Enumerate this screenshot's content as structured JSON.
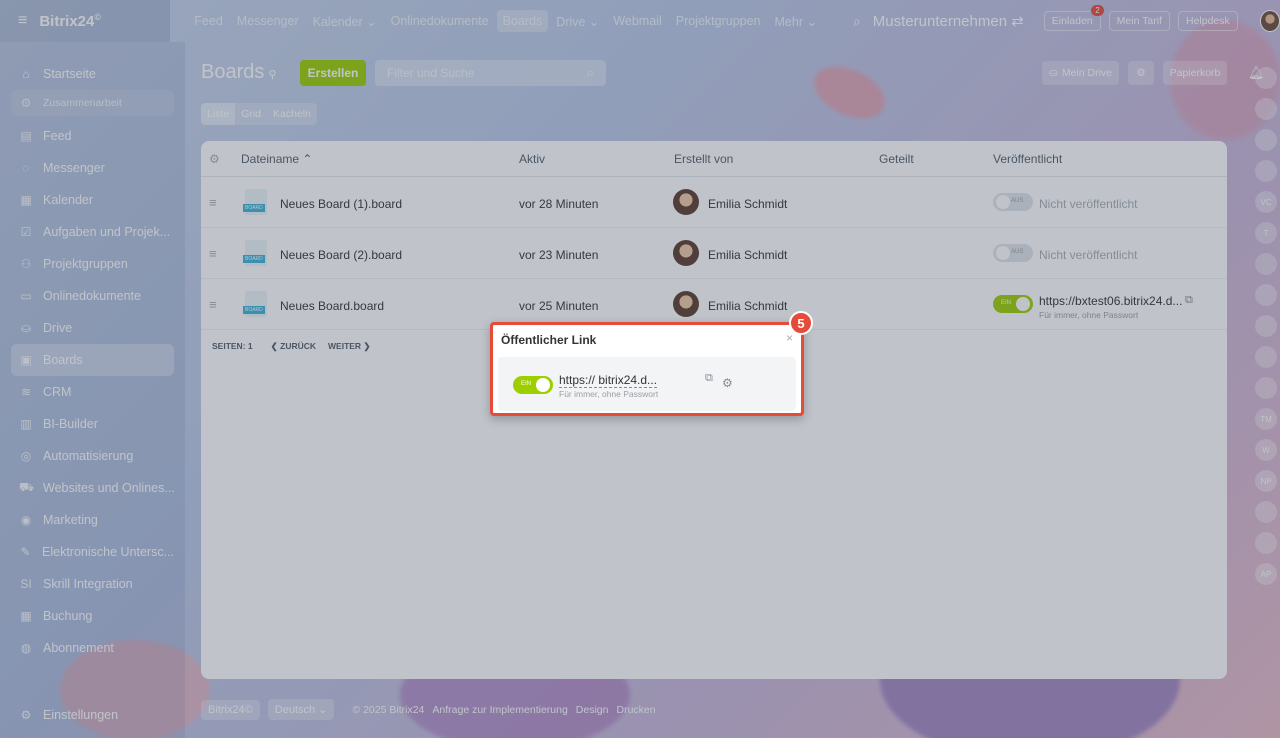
{
  "app": {
    "logo": "Bitrix24",
    "logo_mark": "©"
  },
  "nav": {
    "items": [
      "Feed",
      "Messenger",
      "Kalender ⌄",
      "Onlinedokumente",
      "Boards",
      "Drive ⌄",
      "Webmail",
      "Projektgruppen",
      "Mehr ⌄"
    ],
    "active_index": 4,
    "company": "Musterunternehmen ⇄",
    "invite_label": "Einladen",
    "invite_badge": "2",
    "tariff_label": "Mein Tarif",
    "helpdesk_label": "Helpdesk"
  },
  "sidebar": {
    "items": [
      {
        "icon": "⌂",
        "label": "Startseite",
        "type": "item"
      },
      {
        "icon": "⚙",
        "label": "Zusammenarbeit",
        "type": "section"
      },
      {
        "icon": "▤",
        "label": "Feed",
        "type": "item"
      },
      {
        "icon": "◌",
        "label": "Messenger",
        "type": "item"
      },
      {
        "icon": "▦",
        "label": "Kalender",
        "type": "item"
      },
      {
        "icon": "☑",
        "label": "Aufgaben und Projek...",
        "type": "item"
      },
      {
        "icon": "⚇",
        "label": "Projektgruppen",
        "type": "item"
      },
      {
        "icon": "▭",
        "label": "Onlinedokumente",
        "type": "item"
      },
      {
        "icon": "⛀",
        "label": "Drive",
        "type": "item"
      },
      {
        "icon": "▣",
        "label": "Boards",
        "type": "item",
        "active": true
      },
      {
        "icon": "≋",
        "label": "CRM",
        "type": "item"
      },
      {
        "icon": "▥",
        "label": "BI-Builder",
        "type": "item"
      },
      {
        "icon": "◎",
        "label": "Automatisierung",
        "type": "item"
      },
      {
        "icon": "⛟",
        "label": "Websites und Onlines...",
        "type": "item"
      },
      {
        "icon": "◉",
        "label": "Marketing",
        "type": "item"
      },
      {
        "icon": "✎",
        "label": "Elektronische Untersc...",
        "type": "item"
      },
      {
        "icon": "SI",
        "label": "Skrill Integration",
        "type": "item"
      },
      {
        "icon": "▦",
        "label": "Buchung",
        "type": "item"
      },
      {
        "icon": "◍",
        "label": "Abonnement",
        "type": "item"
      }
    ],
    "settings_label": "Einstellungen"
  },
  "header": {
    "title": "Boards",
    "create_label": "Erstellen",
    "filter_placeholder": "Filter und Suche",
    "my_drive_label": "Mein Drive",
    "trash_label": "Papierkorb",
    "views": [
      "Liste",
      "Grid",
      "Kacheln"
    ],
    "active_view": 0
  },
  "table": {
    "columns": [
      "Dateiname ⌃",
      "Aktiv",
      "Erstellt von",
      "Geteilt",
      "Veröffentlicht"
    ],
    "rows": [
      {
        "name": "Neues Board (1).board",
        "active": "vor 28 Minuten",
        "author": "Emilia Schmidt",
        "published": false,
        "pub_label": "Nicht veröffentlicht",
        "toggle_text": "AUS"
      },
      {
        "name": "Neues Board (2).board",
        "active": "vor 23 Minuten",
        "author": "Emilia Schmidt",
        "published": false,
        "pub_label": "Nicht veröffentlicht",
        "toggle_text": "AUS"
      },
      {
        "name": "Neues Board.board",
        "active": "vor 25 Minuten",
        "author": "Emilia Schmidt",
        "published": true,
        "pub_label": "https://bxtest06.bitrix24.d...",
        "pub_sub": "Für immer, ohne Passwort",
        "toggle_text": "EIN"
      }
    ],
    "file_badge": "BOARD",
    "pager": {
      "pages_label": "SEITEN:",
      "page": "1",
      "back": "❮ ZURÜCK",
      "next": "WEITER ❯"
    }
  },
  "popup": {
    "title": "Öffentlicher Link",
    "close": "×",
    "toggle_text": "EIN",
    "link": "https://          bitrix24.d...",
    "sub": "Für immer, ohne Passwort",
    "step": "5"
  },
  "footer": {
    "brand": "Bitrix24©",
    "language": "Deutsch ⌄",
    "copyright": "© 2025 Bitrix24",
    "links": [
      "Anfrage zur Implementierung",
      "Design",
      "Drucken"
    ]
  },
  "rail": [
    "",
    "",
    "",
    "",
    "VC",
    "T",
    "",
    "",
    "",
    "",
    "",
    "TM",
    "W",
    "NP",
    "",
    "",
    "AP"
  ],
  "colors": {
    "accent_green": "#9dcf00",
    "highlight_red": "#e64b3a"
  }
}
